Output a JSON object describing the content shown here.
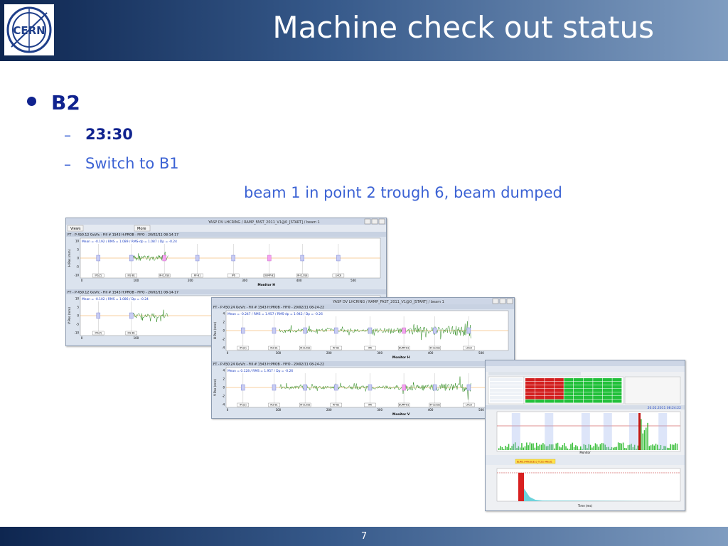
{
  "slide": {
    "title": "Machine check out status",
    "page_number": "7"
  },
  "logo": {
    "text": "CERN"
  },
  "content": {
    "bullet": "B2",
    "sub_items": [
      "23:30",
      "Switch to B1"
    ],
    "caption": "beam 1 in point 2 trough 6, beam dumped"
  },
  "yasp_window_1": {
    "title": "YASP DV LHCRING / RAMP_FAST_2011_V1@0_[START] / beam 1",
    "toolbar": {
      "views": "Views",
      "more": "More"
    },
    "h_plot": {
      "header": "FT - P 450.12 GeV/c - Fill # 1543 H:PROB - FIFO - 20/02/11 08-14-17",
      "stats": "Mean = -0.192 / RMS = 1.089 / RMS-dp = 1.087 / Dp = -0.24",
      "ylabel": "H Pos (mm)",
      "xlabel": "Monitor H",
      "yticks": [
        "10",
        "5",
        "0",
        "-5",
        "-10"
      ],
      "xticks": [
        "0",
        "100",
        "200",
        "300",
        "400",
        "500"
      ],
      "markers": [
        "IP1(Z)",
        "IR2-B1",
        "IR-CLOSE",
        "RF-B1",
        "IP6",
        "DUMP-B1",
        "IR-CLOSE",
        "LHC8"
      ]
    },
    "v_plot": {
      "header": "FT - P 450.12 GeV/c - Fill # 1543 H:PROB - FIFO - 20/02/11 08-14-17",
      "stats": "Mean = -0.102 / RMS = 1.086 / Dp = -0.24",
      "ylabel": "V Pos (mm)",
      "xlabel": "",
      "yticks": [
        "10",
        "5",
        "0",
        "-5",
        "-10"
      ],
      "xticks": [
        "0",
        "100"
      ],
      "markers": [
        "IP1(Z)",
        "IR2-B1"
      ]
    }
  },
  "yasp_window_2": {
    "title": "YASP DV LHCRING / RAMP_FAST_2011_V1@0_[START] / beam 1",
    "h_plot": {
      "header": "FT - P 450.24 GeV/c - Fill # 1543 H:PROB - FIFO - 20/02/11 08-24-22",
      "stats": "Mean = -0.247 / RMS = 1.957 / RMS-dp = 1.942 / Dp = -0.26",
      "ylabel": "H Pos (mm)",
      "xlabel": "Monitor H",
      "yticks": [
        "4",
        "2",
        "0",
        "-2",
        "-4"
      ],
      "xticks": [
        "0",
        "100",
        "200",
        "300",
        "400",
        "500"
      ],
      "markers": [
        "IP1(Z)",
        "IR2-B1",
        "IR-CLOSE",
        "RF-B1",
        "IP6",
        "DUMP-B1",
        "IR-CLOSE",
        "LHC8"
      ]
    },
    "v_plot": {
      "header": "FT - P 450.24 GeV/c - Fill # 1543 H:PROB - FIFO - 20/02/11 08-24-22",
      "stats": "Mean = 0.128 / RMS = 1.957 / Dp = -0.26",
      "ylabel": "V Pos (mm)",
      "xlabel": "Monitor V",
      "yticks": [
        "4",
        "2",
        "0",
        "-2",
        "-4"
      ],
      "xticks": [
        "0",
        "100",
        "200",
        "300",
        "400",
        "500"
      ],
      "markers": [
        "IP1(Z)",
        "IR2-B1",
        "IR-CLOSE",
        "RF-B1",
        "IP6",
        "DUMP-B1",
        "IR-CLOSE",
        "LHC8"
      ]
    }
  },
  "blm_window": {
    "timestamp": "20.02.2011 08:24:22",
    "xlabel": "Monitor",
    "time_xlabel": "Time (ms)",
    "highlight": "BLMEI.04R6.B1E10_TCSG.4R6.B1"
  },
  "colors": {
    "header_start": "#0e2650",
    "header_end": "#7f9cc0",
    "bullet": "#10238f",
    "subtext": "#3b62d4",
    "trace": "#2a8a1e",
    "marker_box": "#9aa6ea",
    "marker_box_pink": "#f4a2f0"
  }
}
